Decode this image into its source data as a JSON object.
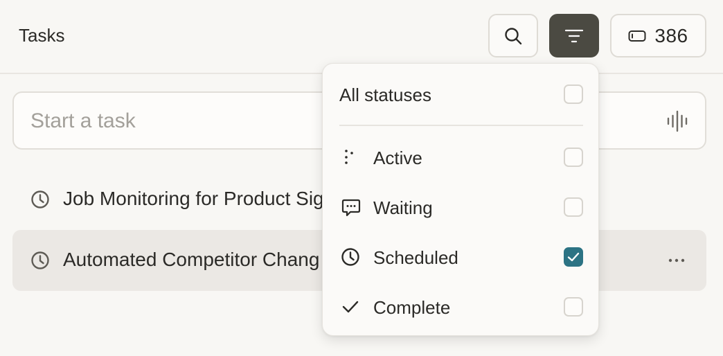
{
  "header": {
    "title": "Tasks",
    "credits": "386"
  },
  "composer": {
    "placeholder": "Start a task",
    "value": ""
  },
  "tasks": [
    {
      "label": "Job Monitoring for Product Sig",
      "icon": "clock-icon"
    },
    {
      "label": "Automated Competitor Chang",
      "icon": "clock-icon"
    }
  ],
  "status_filter": {
    "all_label": "All statuses",
    "all_checked": false,
    "items": [
      {
        "label": "Active",
        "icon": "dots-icon",
        "checked": false
      },
      {
        "label": "Waiting",
        "icon": "chat-bubble-icon",
        "checked": false
      },
      {
        "label": "Scheduled",
        "icon": "clock-icon",
        "checked": true
      },
      {
        "label": "Complete",
        "icon": "checkmark-icon",
        "checked": false
      }
    ]
  },
  "colors": {
    "background": "#f8f7f4",
    "filter_button_active": "#4b4a42",
    "checkbox_checked": "#2c7384",
    "selected_row": "#ebe8e4"
  }
}
